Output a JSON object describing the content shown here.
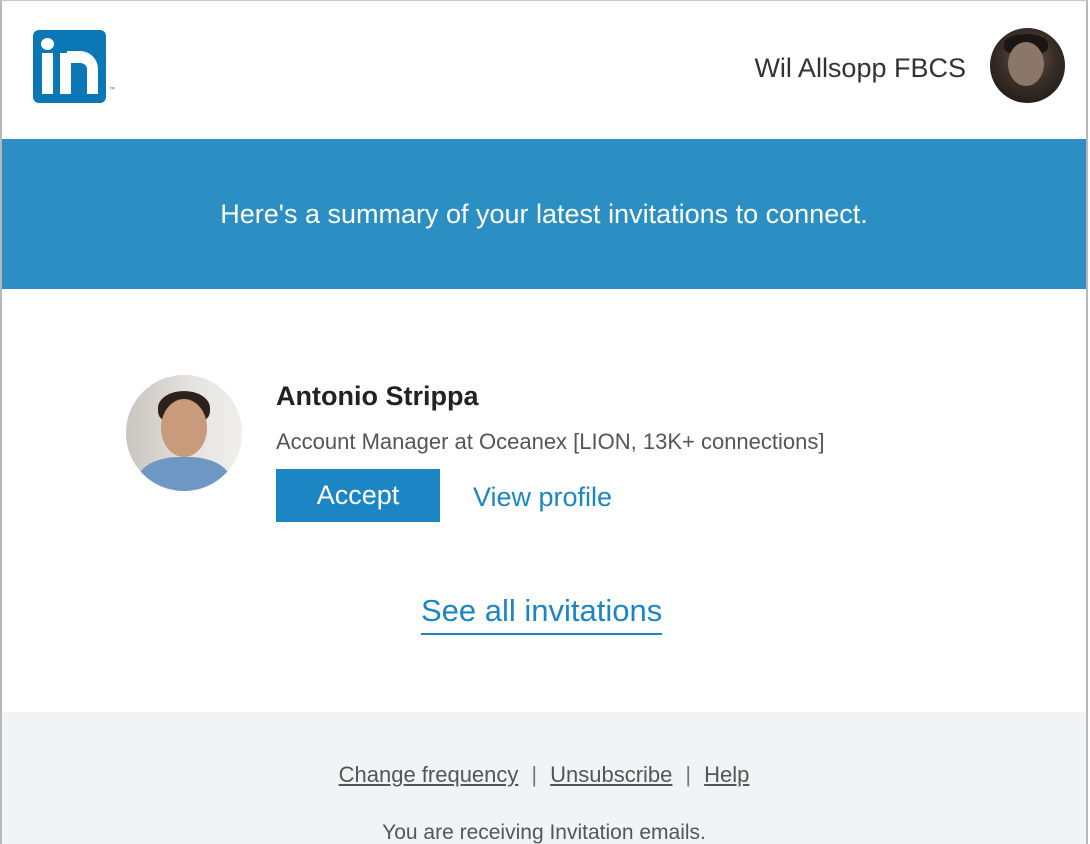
{
  "header": {
    "user_name": "Wil Allsopp FBCS",
    "logo_text": "in",
    "logo_tm": "™"
  },
  "banner": {
    "text": "Here's a summary of your latest invitations to connect."
  },
  "invitation": {
    "name": "Antonio Strippa",
    "headline": "Account Manager at Oceanex [LION, 13K+ connections]",
    "accept_label": "Accept",
    "view_profile_label": "View profile"
  },
  "see_all_label": "See all invitations",
  "footer": {
    "links": [
      "Change frequency",
      "Unsubscribe",
      "Help"
    ],
    "separator": "|",
    "note": "You are receiving Invitation emails."
  },
  "colors": {
    "brand_blue": "#0b77b5",
    "banner_blue": "#2b8fc3",
    "link_blue": "#1c86c5",
    "footer_bg": "#f2f3f5"
  },
  "icons": {
    "logo": "linkedin-logo-icon",
    "user_avatar": "user-avatar",
    "sender_avatar": "sender-avatar"
  }
}
